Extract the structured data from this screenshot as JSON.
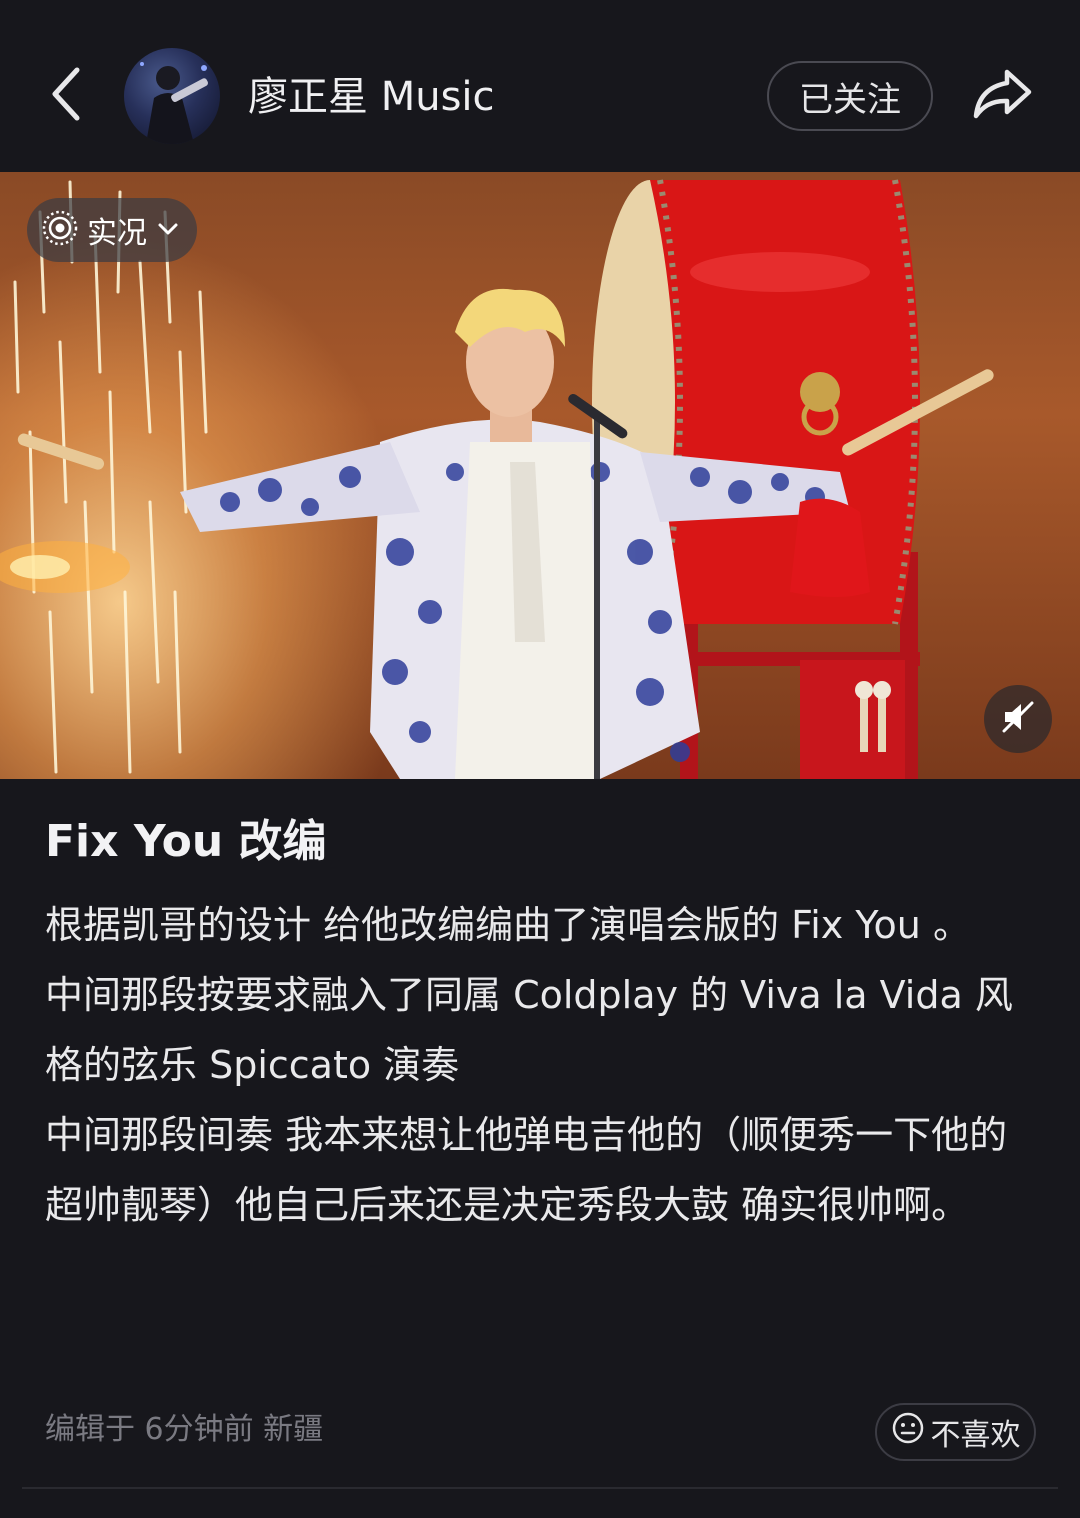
{
  "header": {
    "author_name": "廖正星 Music",
    "follow_label": "已关注",
    "back_icon": "chevron-left-icon",
    "share_icon": "share-arrow-icon"
  },
  "media": {
    "live_badge_label": "实况",
    "live_icon": "live-photo-icon",
    "badge_chevron_icon": "chevron-down-icon",
    "mute_icon": "speaker-muted-icon"
  },
  "post": {
    "title": "Fix You 改编",
    "paragraphs": [
      "根据凯哥的设计 给他改编编曲了演唱会版的 Fix You 。",
      "中间那段按要求融入了同属 Coldplay 的 Viva la Vida 风格的弦乐 Spiccato 演奏",
      "中间那段间奏 我本来想让他弹电吉他的（顺便秀一下他的超帅靓琴）他自己后来还是决定秀段大鼓 确实很帅啊。"
    ]
  },
  "footer": {
    "meta": "编辑于 6分钟前 新疆",
    "dislike_label": "不喜欢",
    "dislike_icon": "neutral-face-icon"
  },
  "colors": {
    "background": "#17171c",
    "text_primary": "#e9e9eb",
    "text_muted": "#7a7a82",
    "drum_red": "#d61a1a"
  }
}
